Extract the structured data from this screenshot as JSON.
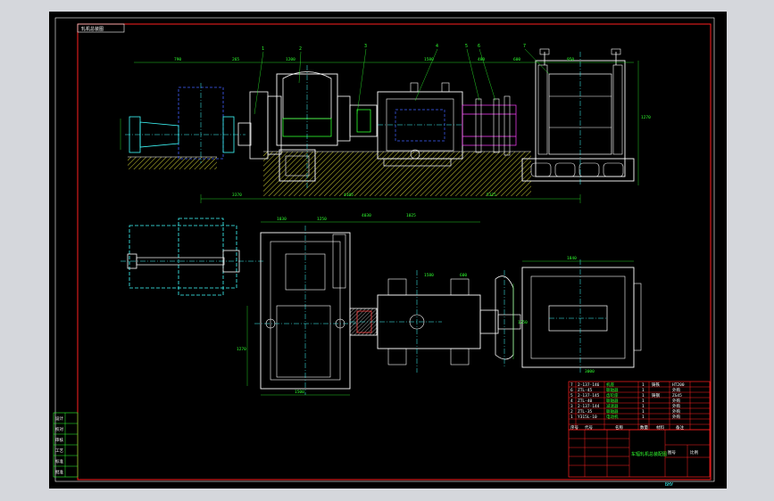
{
  "drawing": {
    "name_box": "轧机总装图",
    "sheet_scale": "比例",
    "corner_mark": "图号",
    "bottom_mark": "БНУ",
    "title_text": "车辐轧机总装配图",
    "colors": {
      "background": "#000000",
      "frame": "#ff2020",
      "outline": "#ffffff",
      "part_lines": "#2fff2f",
      "cutting": "#ffff40",
      "center_lines": "#3fffff",
      "hidden": "#4040ff",
      "highlight": "#ff40ff"
    },
    "part_numbers": [
      "1",
      "2",
      "3",
      "4",
      "5",
      "6",
      "7"
    ],
    "dimensions_top": [
      "790",
      "265",
      "1200",
      "4185",
      "1580",
      "480",
      "600",
      "950",
      "1270",
      "3370",
      "5325"
    ],
    "dimensions_bottom": [
      "1030",
      "1250",
      "4030",
      "1025",
      "1580",
      "600",
      "1840",
      "1270",
      "1500",
      "1250",
      "3000"
    ],
    "bom_rows": [
      {
        "no": "7",
        "code": "2-137-146",
        "name": "机座",
        "qty": "1",
        "mat": "铸铁",
        "note": "HT200"
      },
      {
        "no": "6",
        "code": "ZTL-45",
        "name": "联轴器",
        "qty": "1",
        "mat": "",
        "note": "外购"
      },
      {
        "no": "5",
        "code": "2-137-145",
        "name": "齿轮座",
        "qty": "1",
        "mat": "铸钢",
        "note": "ZG45"
      },
      {
        "no": "4",
        "code": "ZTL-40",
        "name": "联轴器",
        "qty": "1",
        "mat": "",
        "note": "外购"
      },
      {
        "no": "3",
        "code": "2-137-144",
        "name": "减速器",
        "qty": "1",
        "mat": "",
        "note": "外购"
      },
      {
        "no": "2",
        "code": "ZTL-35",
        "name": "联轴器",
        "qty": "1",
        "mat": "",
        "note": "外购"
      },
      {
        "no": "1",
        "code": "Y315L-10",
        "name": "电动机",
        "qty": "1",
        "mat": "",
        "note": "外购"
      }
    ],
    "bom_header": [
      "序号",
      "代号",
      "名称",
      "数量",
      "材料",
      "备注"
    ],
    "left_table": [
      "设计",
      "校对",
      "审核",
      "工艺",
      "标准",
      "批准"
    ]
  }
}
